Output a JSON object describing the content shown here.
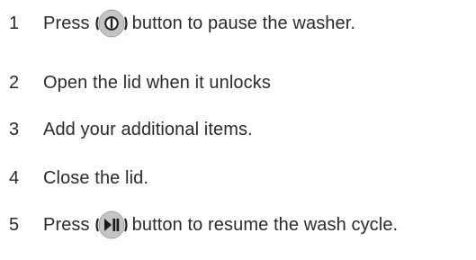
{
  "steps": [
    {
      "number": "1",
      "before": "Press",
      "icon": "power-button-icon",
      "after": "button to pause the washer."
    },
    {
      "number": "2",
      "text": "Open the lid when it unlocks"
    },
    {
      "number": "3",
      "text": "Add your additional items."
    },
    {
      "number": "4",
      "text": "Close the lid."
    },
    {
      "number": "5",
      "before": "Press",
      "icon": "play-pause-button-icon",
      "after": "button to resume the wash cycle."
    }
  ]
}
